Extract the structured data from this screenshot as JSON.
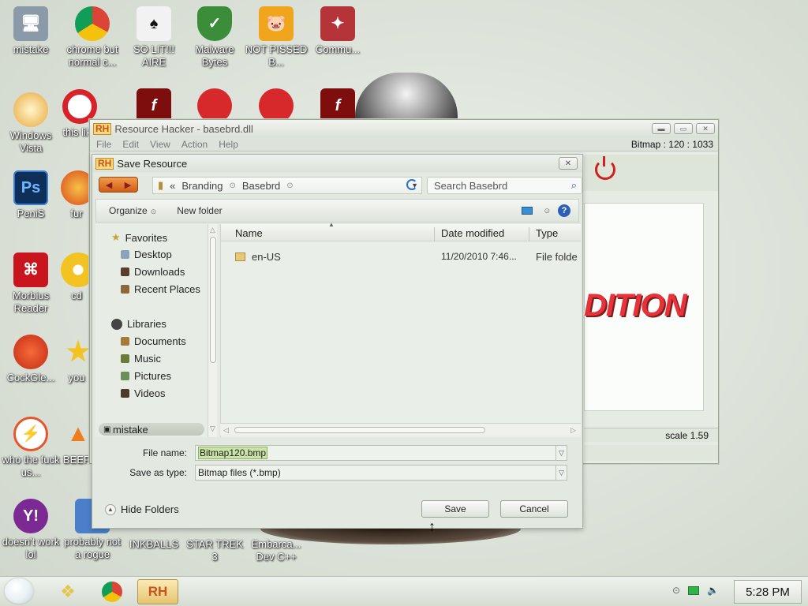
{
  "desktop": {
    "icons": [
      {
        "label": "mistake"
      },
      {
        "label": "chrome but normal c..."
      },
      {
        "label": "SO LIT!!! AIRE"
      },
      {
        "label": "Malware Bytes"
      },
      {
        "label": "NOT PISSED B..."
      },
      {
        "label": "Commu..."
      },
      {
        "label": "Windows Vista"
      },
      {
        "label": "this like"
      },
      {
        "label": "PeniS"
      },
      {
        "label": "fur"
      },
      {
        "label": "Morbius Reader"
      },
      {
        "label": "cd"
      },
      {
        "label": "CockGle..."
      },
      {
        "label": "you"
      },
      {
        "label": "who the fuck us..."
      },
      {
        "label": "BEEF"
      },
      {
        "label": "doesn't work lol"
      },
      {
        "label": "probably not a rogue"
      },
      {
        "label": "INKBALLS"
      },
      {
        "label": "STAR TREK 3"
      },
      {
        "label": "Embarca... Dev C++"
      }
    ]
  },
  "resource_hacker": {
    "title": "Resource Hacker - basebrd.dll",
    "logo": "RH",
    "menu": [
      "File",
      "Edit",
      "View",
      "Action",
      "Help"
    ],
    "status": "Bitmap : 120 : 1033",
    "preview_text": "DITION",
    "scale": "scale 1.59"
  },
  "save_dialog": {
    "title": "Save Resource",
    "logo": "RH",
    "breadcrumb": [
      "Branding",
      "Basebrd"
    ],
    "breadcrumb_prefix": "«",
    "search_placeholder": "Search Basebrd",
    "toolbar": {
      "organize": "Organize",
      "new_folder": "New folder"
    },
    "nav": {
      "favorites": "Favorites",
      "favorites_items": [
        "Desktop",
        "Downloads",
        "Recent Places"
      ],
      "libraries": "Libraries",
      "libraries_items": [
        "Documents",
        "Music",
        "Pictures",
        "Videos"
      ],
      "selected": "mistake"
    },
    "columns": {
      "name": "Name",
      "date": "Date modified",
      "type": "Type"
    },
    "files": [
      {
        "name": "en-US",
        "date": "11/20/2010 7:46...",
        "type": "File folde"
      }
    ],
    "file_name_label": "File name:",
    "file_name_value": "Bitmap120.bmp",
    "save_type_label": "Save as type:",
    "save_type_value": "Bitmap files (*.bmp)",
    "hide_folders": "Hide Folders",
    "save_button": "Save",
    "cancel_button": "Cancel"
  },
  "taskbar": {
    "rh_label": "RH",
    "clock": "5:28 PM"
  }
}
